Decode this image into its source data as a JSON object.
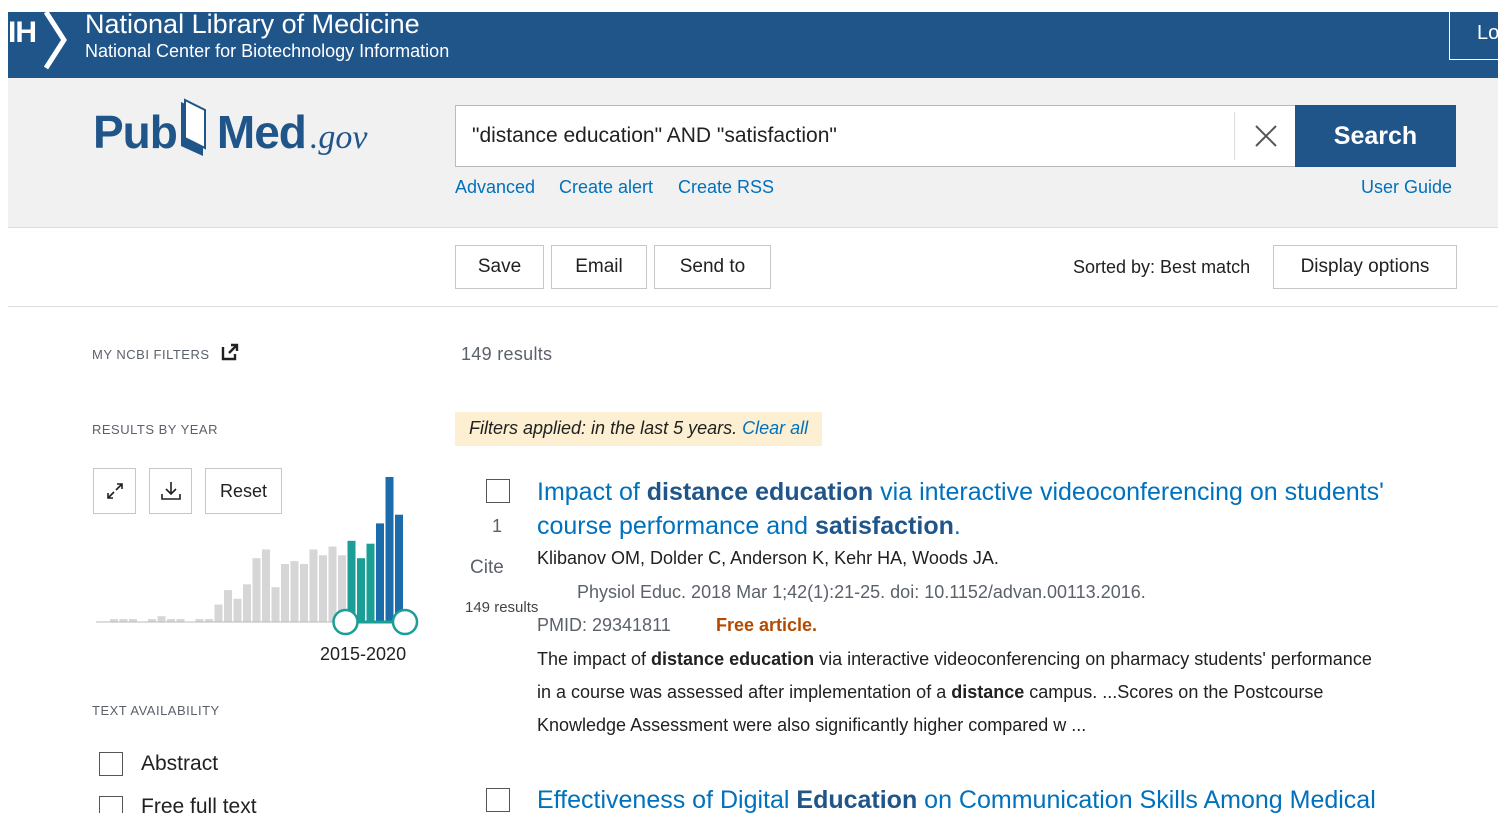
{
  "banner": {
    "logo_text": "IH",
    "title": "National Library of Medicine",
    "subtitle": "National Center for Biotechnology Information",
    "login_label": "Lo"
  },
  "header": {
    "logo": {
      "pub": "Pub",
      "med": "Med",
      "gov": ".gov"
    },
    "search": {
      "value": "\"distance education\" AND \"satisfaction\"",
      "button_label": "Search"
    },
    "links": {
      "advanced": "Advanced",
      "create_alert": "Create alert",
      "create_rss": "Create RSS",
      "user_guide": "User Guide"
    }
  },
  "toolbar": {
    "save_label": "Save",
    "email_label": "Email",
    "send_to_label": "Send to",
    "sorted_label": "Sorted by: Best match",
    "display_options_label": "Display options"
  },
  "sidebar": {
    "my_filters_label": "MY NCBI FILTERS",
    "results_by_year_label": "RESULTS BY YEAR",
    "reset_label": "Reset",
    "range_label": "2015-2020",
    "text_availability_label": "TEXT AVAILABILITY",
    "filters": [
      {
        "label": "Abstract",
        "checked": false
      },
      {
        "label": "Free full text",
        "checked": false
      }
    ]
  },
  "results": {
    "count_label": "149 results",
    "tooltip": "149 results",
    "filter_banner": {
      "text": "Filters applied: in the last 5 years.",
      "clear_label": "Clear all"
    },
    "items": [
      {
        "number": "1",
        "cite_label": "Cite",
        "title_parts": [
          {
            "t": "Impact of ",
            "b": false
          },
          {
            "t": "distance education",
            "b": true
          },
          {
            "t": " via interactive videoconferencing on students'",
            "b": false
          }
        ],
        "title_parts_line2": [
          {
            "t": "course performance and ",
            "b": false
          },
          {
            "t": "satisfaction",
            "b": true
          },
          {
            "t": ".",
            "b": false
          }
        ],
        "authors": "Klibanov OM, Dolder C, Anderson K, Kehr HA, Woods JA.",
        "journal": "Physiol Educ. 2018 Mar 1;42(1):21-25. doi: 10.1152/advan.00113.2016.",
        "pmid": "PMID: 29341811",
        "free_label": "Free article.",
        "snippet_lines": [
          [
            {
              "t": "The impact of ",
              "b": false
            },
            {
              "t": "distance education",
              "b": true
            },
            {
              "t": " via interactive videoconferencing on pharmacy students' performance",
              "b": false
            }
          ],
          [
            {
              "t": "in a course was assessed after implementation of a ",
              "b": false
            },
            {
              "t": "distance",
              "b": true
            },
            {
              "t": " campus. ...Scores on the Postcourse",
              "b": false
            }
          ],
          [
            {
              "t": "Knowledge Assessment were also significantly higher compared w ...",
              "b": false
            }
          ]
        ]
      },
      {
        "title_parts": [
          {
            "t": "Effectiveness of Digital ",
            "b": false
          },
          {
            "t": "Education",
            "b": true
          },
          {
            "t": " on Communication Skills Among Medical",
            "b": false
          }
        ]
      }
    ]
  },
  "chart_data": {
    "type": "bar",
    "title": "",
    "xlabel": "",
    "ylabel": "",
    "x": [
      1990,
      1991,
      1992,
      1993,
      1994,
      1995,
      1996,
      1997,
      1998,
      1999,
      2000,
      2001,
      2002,
      2003,
      2004,
      2005,
      2006,
      2007,
      2008,
      2009,
      2010,
      2011,
      2012,
      2013,
      2014,
      2015,
      2016,
      2017,
      2018,
      2019,
      2020
    ],
    "values": [
      1,
      1,
      1,
      0,
      1,
      2,
      1,
      1,
      0,
      1,
      1,
      6,
      11,
      8,
      13,
      22,
      25,
      12,
      20,
      21,
      20,
      25,
      23,
      26,
      23,
      28,
      22,
      27,
      34,
      50,
      37
    ],
    "selected_range": [
      2015,
      2020
    ],
    "colors": {
      "default": "#d6d6d6",
      "selected": "#1a9e96",
      "selected_top": "#1c6bab",
      "handle": "#1a9e96"
    }
  },
  "colors": {
    "brand": "#20558a",
    "link": "#0071bc",
    "free": "#b34a00",
    "filter_bg": "#fdf0d2"
  }
}
